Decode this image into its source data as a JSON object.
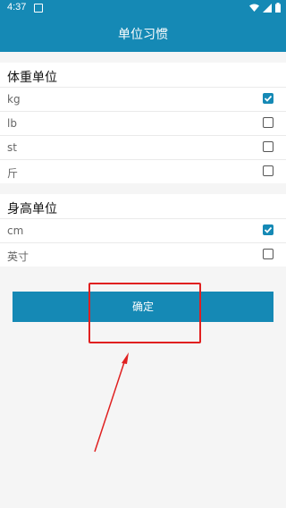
{
  "status_bar": {
    "time": "4:37"
  },
  "app_bar": {
    "title": "单位习惯"
  },
  "weight_section": {
    "title": "体重单位",
    "options": [
      {
        "label": "kg",
        "checked": true
      },
      {
        "label": "lb",
        "checked": false
      },
      {
        "label": "st",
        "checked": false
      },
      {
        "label": "斤",
        "checked": false
      }
    ]
  },
  "height_section": {
    "title": "身高单位",
    "options": [
      {
        "label": "cm",
        "checked": true
      },
      {
        "label": "英寸",
        "checked": false
      }
    ]
  },
  "confirm_button": {
    "label": "确定"
  },
  "colors": {
    "accent": "#1589b5",
    "annotation": "#e02020"
  }
}
